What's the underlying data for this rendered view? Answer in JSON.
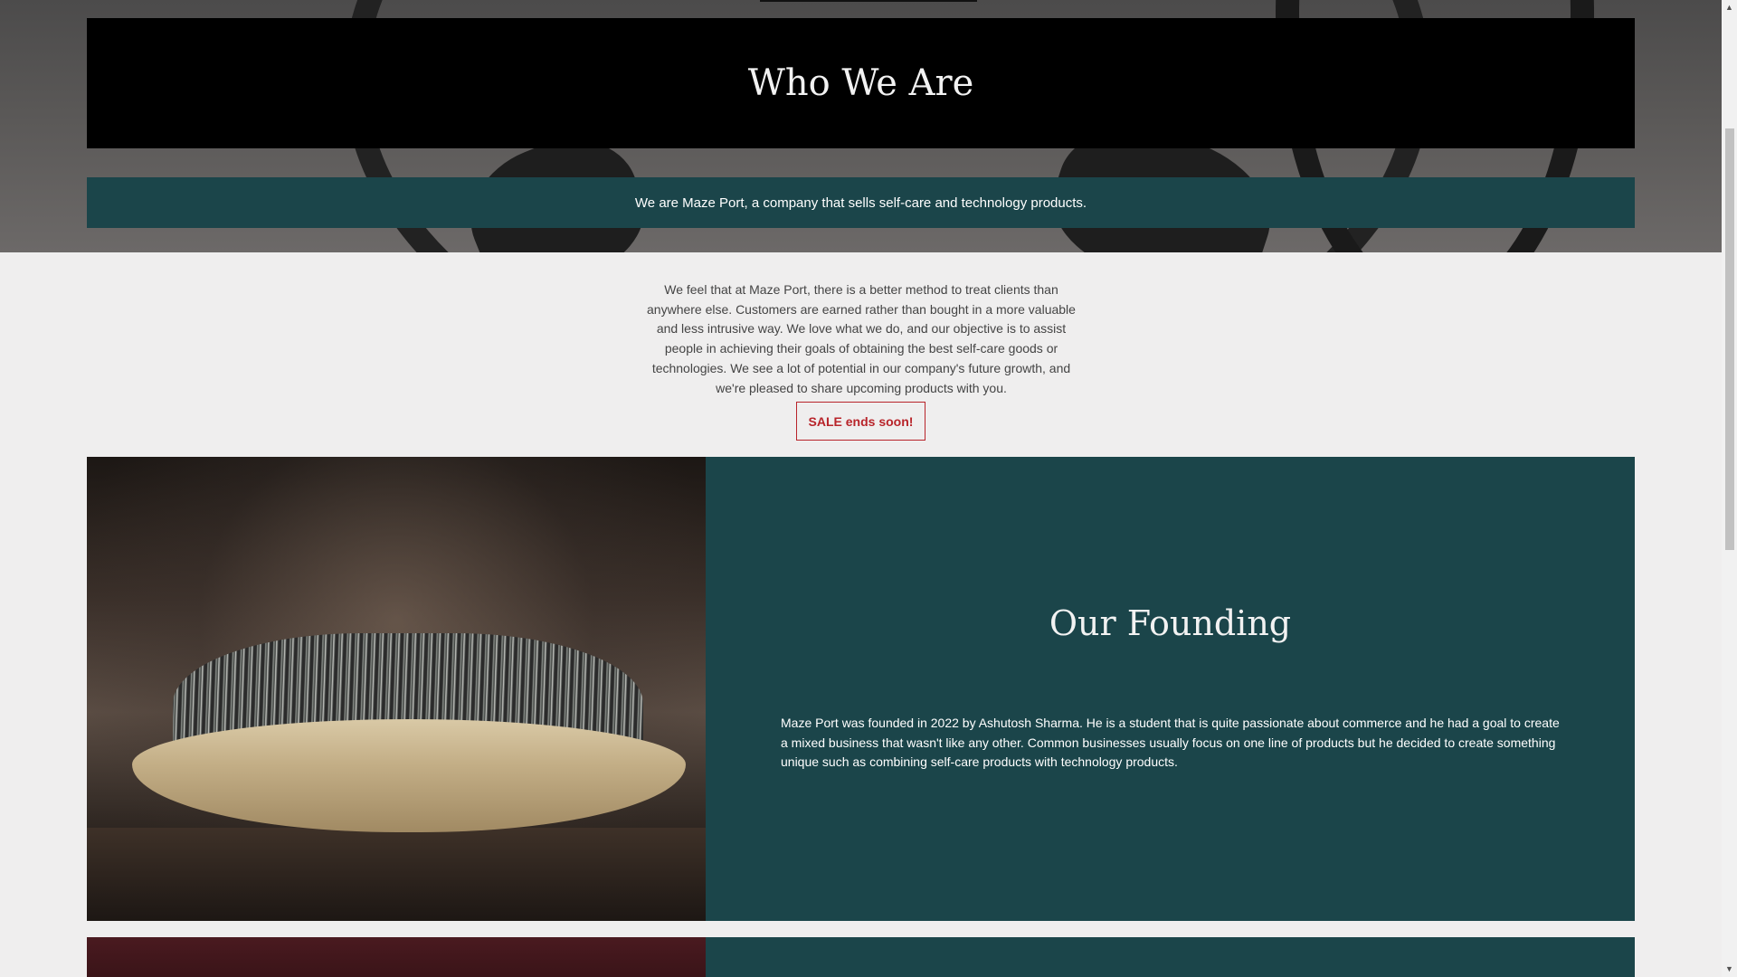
{
  "hero": {
    "title": "Who We Are",
    "tagline": "We are Maze Port, a company that sells self-care and technology products."
  },
  "intro": {
    "body": "We feel that at Maze Port, there is a better method to treat clients than anywhere else. Customers are earned rather than bought in a more valuable and less intrusive way. We love what we do, and our objective is to assist people in achieving their goals of obtaining the best self-care goods or technologies. We see a lot of potential in our company's future growth, and we're pleased to share upcoming products with you.",
    "button_label": "SALE ends soon!"
  },
  "founding": {
    "title": "Our Founding",
    "body": "Maze Port was founded in 2022 by Ashutosh Sharma. He is a student that is quite passionate about commerce and he had a goal to create a mixed business that wasn't like any other. Common businesses usually focus on one line of products but he decided to create something unique such as combining self-care products with technology products."
  },
  "scrollbar": {
    "up_icon": "▲",
    "down_icon": "▼"
  },
  "colors": {
    "teal_panel": "#1b454a",
    "title_box": "#000000",
    "sale_accent": "#b8242a",
    "page_background": "#efeeee"
  }
}
